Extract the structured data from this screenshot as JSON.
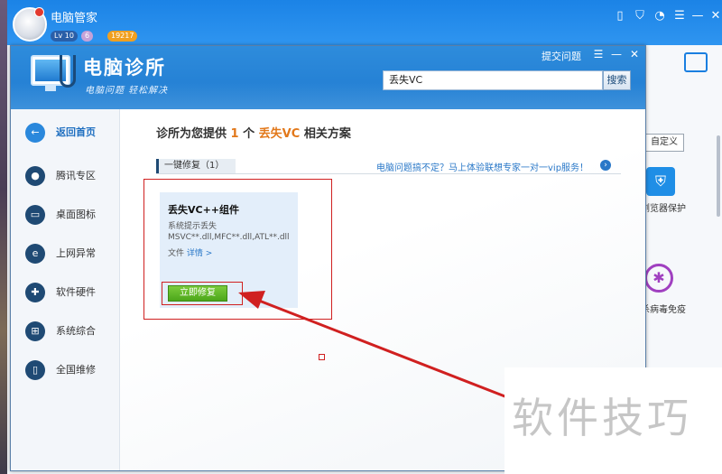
{
  "outer": {
    "title": "电脑管家",
    "badge_level": "Lv 10",
    "badge_crown": "6",
    "badge_coin": "19217",
    "custom_button": "自定义",
    "shield_label": "浏览器保护",
    "virus_label": "杀病毒免疫"
  },
  "inner": {
    "logo_title": "电脑诊所",
    "logo_slogan": "电脑问题 轻松解决",
    "feedback_link": "提交问题",
    "search_value": "丢失VC",
    "search_button": "搜索"
  },
  "nav": {
    "back": "返回首页",
    "items": [
      "腾讯专区",
      "桌面图标",
      "上网异常",
      "软件硬件",
      "系统综合",
      "全国维修"
    ]
  },
  "content": {
    "title_prefix": "诊所为您提供",
    "title_count": "1",
    "title_mid": "个",
    "title_keyword": "丢失VC",
    "title_suffix": "相关方案",
    "section_tab": "一键修复（1）",
    "vip_link": "电脑问题搞不定？马上体验联想专家一对一vip服务！",
    "card_title": "丢失VC++组件",
    "card_desc_1": "系统提示丢失",
    "card_desc_2": "MSVC**.dll,MFC**.dll,ATL**.dll",
    "card_desc_3": "文件",
    "card_detail": "详情 >",
    "fix_button": "立即修复"
  },
  "watermark": "软件技巧",
  "colors": {
    "accent": "#1f7ad0",
    "highlight": "#e2781a",
    "annotation_red": "#d02020",
    "fix_green": "#4ca61a"
  }
}
